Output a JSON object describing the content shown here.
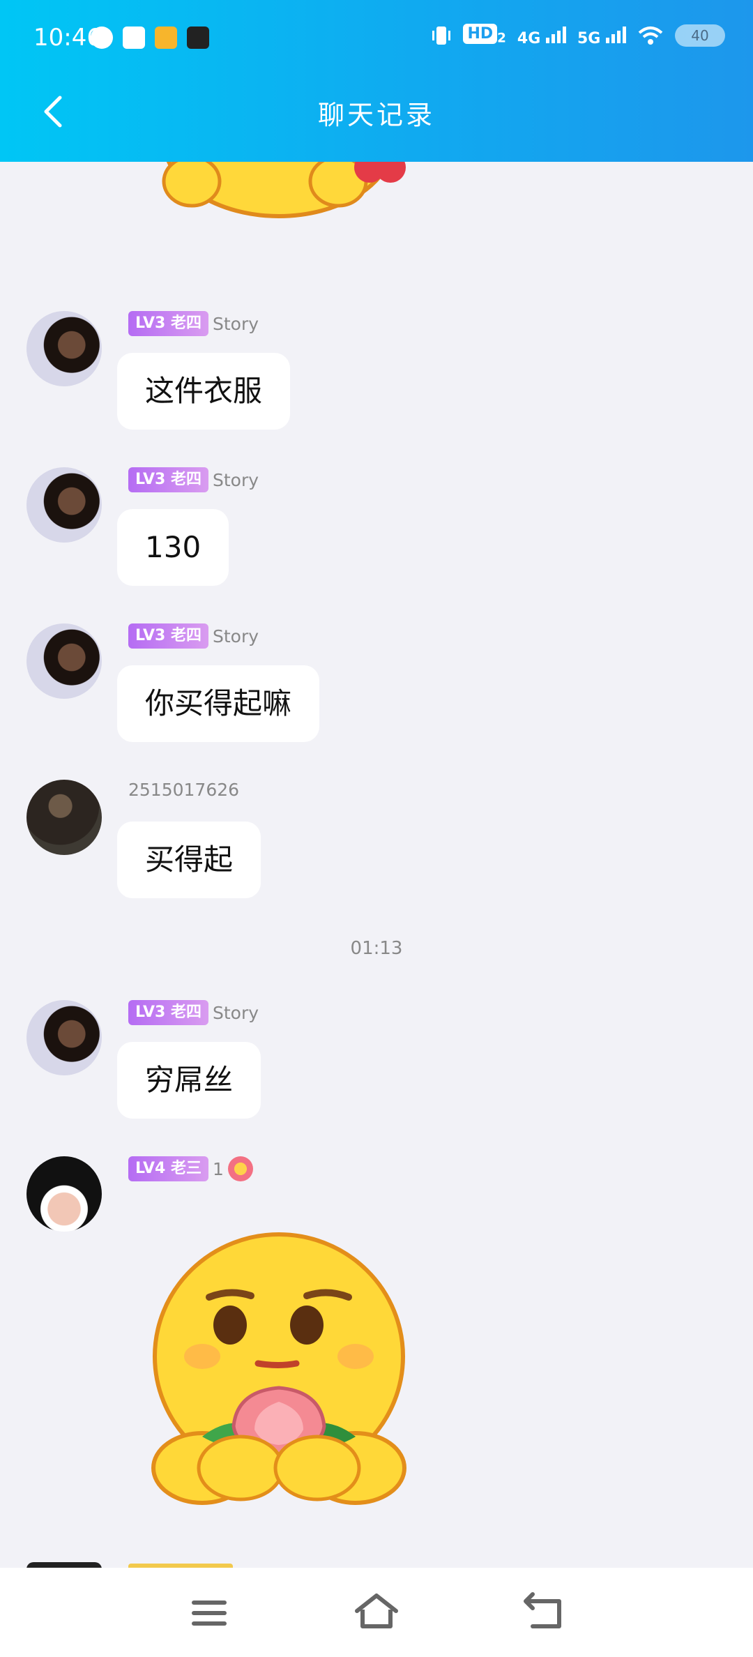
{
  "status_bar": {
    "time": "10:46",
    "hd": "HD",
    "hd_sub": "2",
    "network_1": "4G",
    "network_2": "5G",
    "battery": "40"
  },
  "header": {
    "title": "聊天记录"
  },
  "messages": [
    {
      "badge": "LV3 老四",
      "nick": "Story",
      "text": "这件衣服"
    },
    {
      "badge": "LV3 老四",
      "nick": "Story",
      "text": "130"
    },
    {
      "badge": "LV3 老四",
      "nick": "Story",
      "text": "你买得起嘛"
    },
    {
      "nick": "2515017626",
      "text": "买得起"
    },
    {
      "badge": "LV3 老四",
      "nick": "Story",
      "text": "穷屌丝"
    },
    {
      "badge": "LV4 老三",
      "nick": "1"
    }
  ],
  "timestamp": "01:13",
  "colors": {
    "header_gradient_start": "#00c6f5",
    "header_gradient_end": "#1d97ec",
    "background": "#f2f2f7",
    "level_badge": "#c17af2"
  },
  "icons": [
    "back-arrow-icon",
    "menu-icon",
    "home-icon",
    "return-icon"
  ]
}
